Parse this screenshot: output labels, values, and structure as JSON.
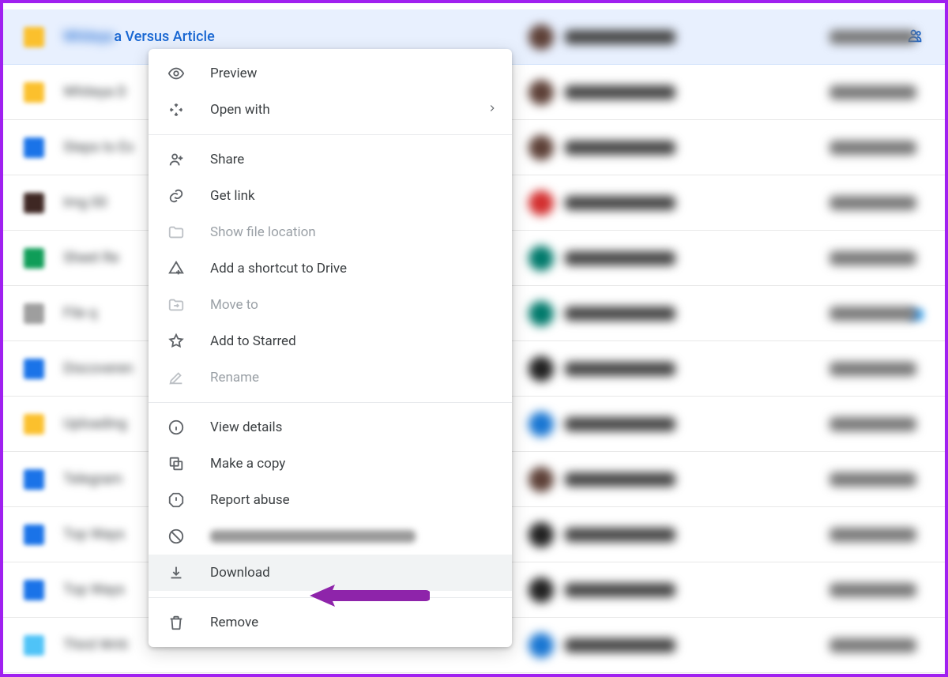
{
  "selected_file": {
    "name_visible_suffix": "a Versus Article",
    "shared": true
  },
  "context_menu": {
    "preview": "Preview",
    "open_with": "Open with",
    "share": "Share",
    "get_link": "Get link",
    "show_location": "Show file location",
    "add_shortcut": "Add a shortcut to Drive",
    "move_to": "Move to",
    "add_starred": "Add to Starred",
    "rename": "Rename",
    "view_details": "View details",
    "make_copy": "Make a copy",
    "report_abuse": "Report abuse",
    "download": "Download",
    "remove": "Remove"
  },
  "background_rows_partial_text": {
    "row1": "a D",
    "row2": "Ex",
    "row3": "00",
    "row4": "Re",
    "row6": "en",
    "row7": "g",
    "row8": "am",
    "row9": "ay",
    "row10": "ays",
    "row11": "riti"
  },
  "annotation": {
    "arrow_color": "#8e24aa",
    "points_to": "download"
  }
}
